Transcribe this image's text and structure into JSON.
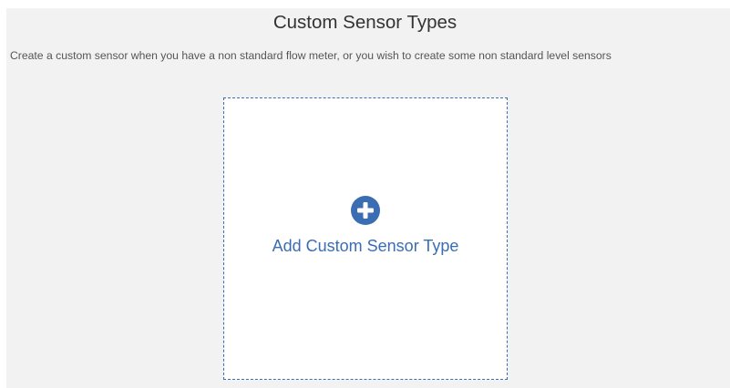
{
  "header": {
    "title": "Custom Sensor Types",
    "description": "Create a custom sensor when you have a non standard flow meter, or you wish to create some non standard level sensors"
  },
  "add_card": {
    "label": "Add Custom Sensor Type",
    "icon": "plus-circle-icon"
  },
  "colors": {
    "accent": "#3b6db3",
    "panel_background": "#f2f2f2",
    "card_background": "#ffffff"
  }
}
